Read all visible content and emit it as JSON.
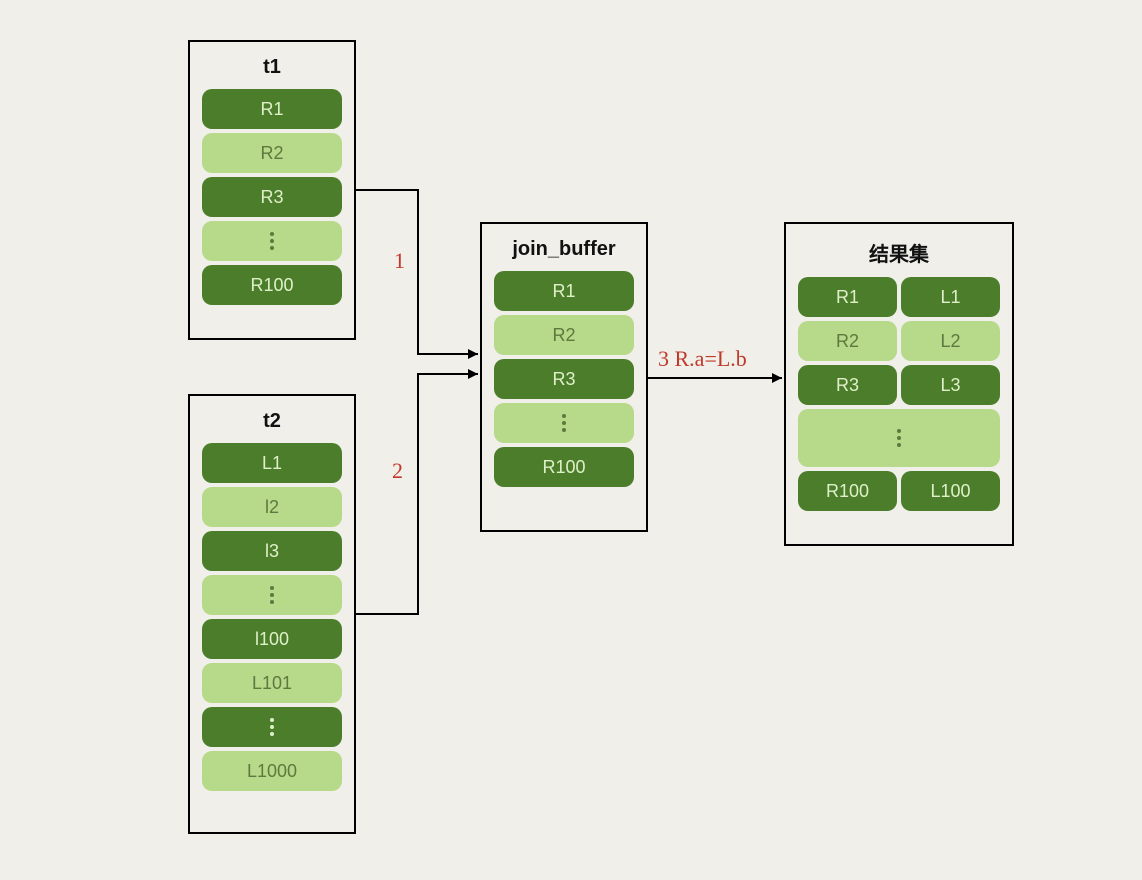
{
  "colors": {
    "bg": "#f0efe9",
    "border": "#000000",
    "dark_fill": "#4b7d2b",
    "dark_text": "#dff0c9",
    "light_fill": "#b7d98a",
    "light_text": "#5c7a3d",
    "annot": "#c0392b"
  },
  "t1": {
    "title": "t1",
    "rows": [
      {
        "label": "R1",
        "style": "dark"
      },
      {
        "label": "R2",
        "style": "light"
      },
      {
        "label": "R3",
        "style": "dark"
      },
      {
        "label": "⋮",
        "style": "vdots-light"
      },
      {
        "label": "R100",
        "style": "dark"
      }
    ]
  },
  "t2": {
    "title": "t2",
    "rows": [
      {
        "label": "L1",
        "style": "dark"
      },
      {
        "label": "l2",
        "style": "light"
      },
      {
        "label": "l3",
        "style": "dark"
      },
      {
        "label": "⋮",
        "style": "vdots-light"
      },
      {
        "label": "l100",
        "style": "dark"
      },
      {
        "label": "L101",
        "style": "light"
      },
      {
        "label": "⋮",
        "style": "vdots-dark"
      },
      {
        "label": "L1000",
        "style": "light"
      }
    ]
  },
  "join_buffer": {
    "title": "join_buffer",
    "rows": [
      {
        "label": "R1",
        "style": "dark"
      },
      {
        "label": "R2",
        "style": "light"
      },
      {
        "label": "R3",
        "style": "dark"
      },
      {
        "label": "⋮",
        "style": "vdots-light"
      },
      {
        "label": "R100",
        "style": "dark"
      }
    ]
  },
  "result": {
    "title": "结果集",
    "pairs": [
      {
        "left": "R1",
        "right": "L1",
        "style": "dark"
      },
      {
        "left": "R2",
        "right": "L2",
        "style": "light"
      },
      {
        "left": "R3",
        "right": "L3",
        "style": "dark"
      },
      {
        "vdots": true
      },
      {
        "left": "R100",
        "right": "L100",
        "style": "dark"
      }
    ]
  },
  "edges": {
    "e1": {
      "label": "1"
    },
    "e2": {
      "label": "2"
    },
    "e3": {
      "label": "3 R.a=L.b"
    }
  }
}
